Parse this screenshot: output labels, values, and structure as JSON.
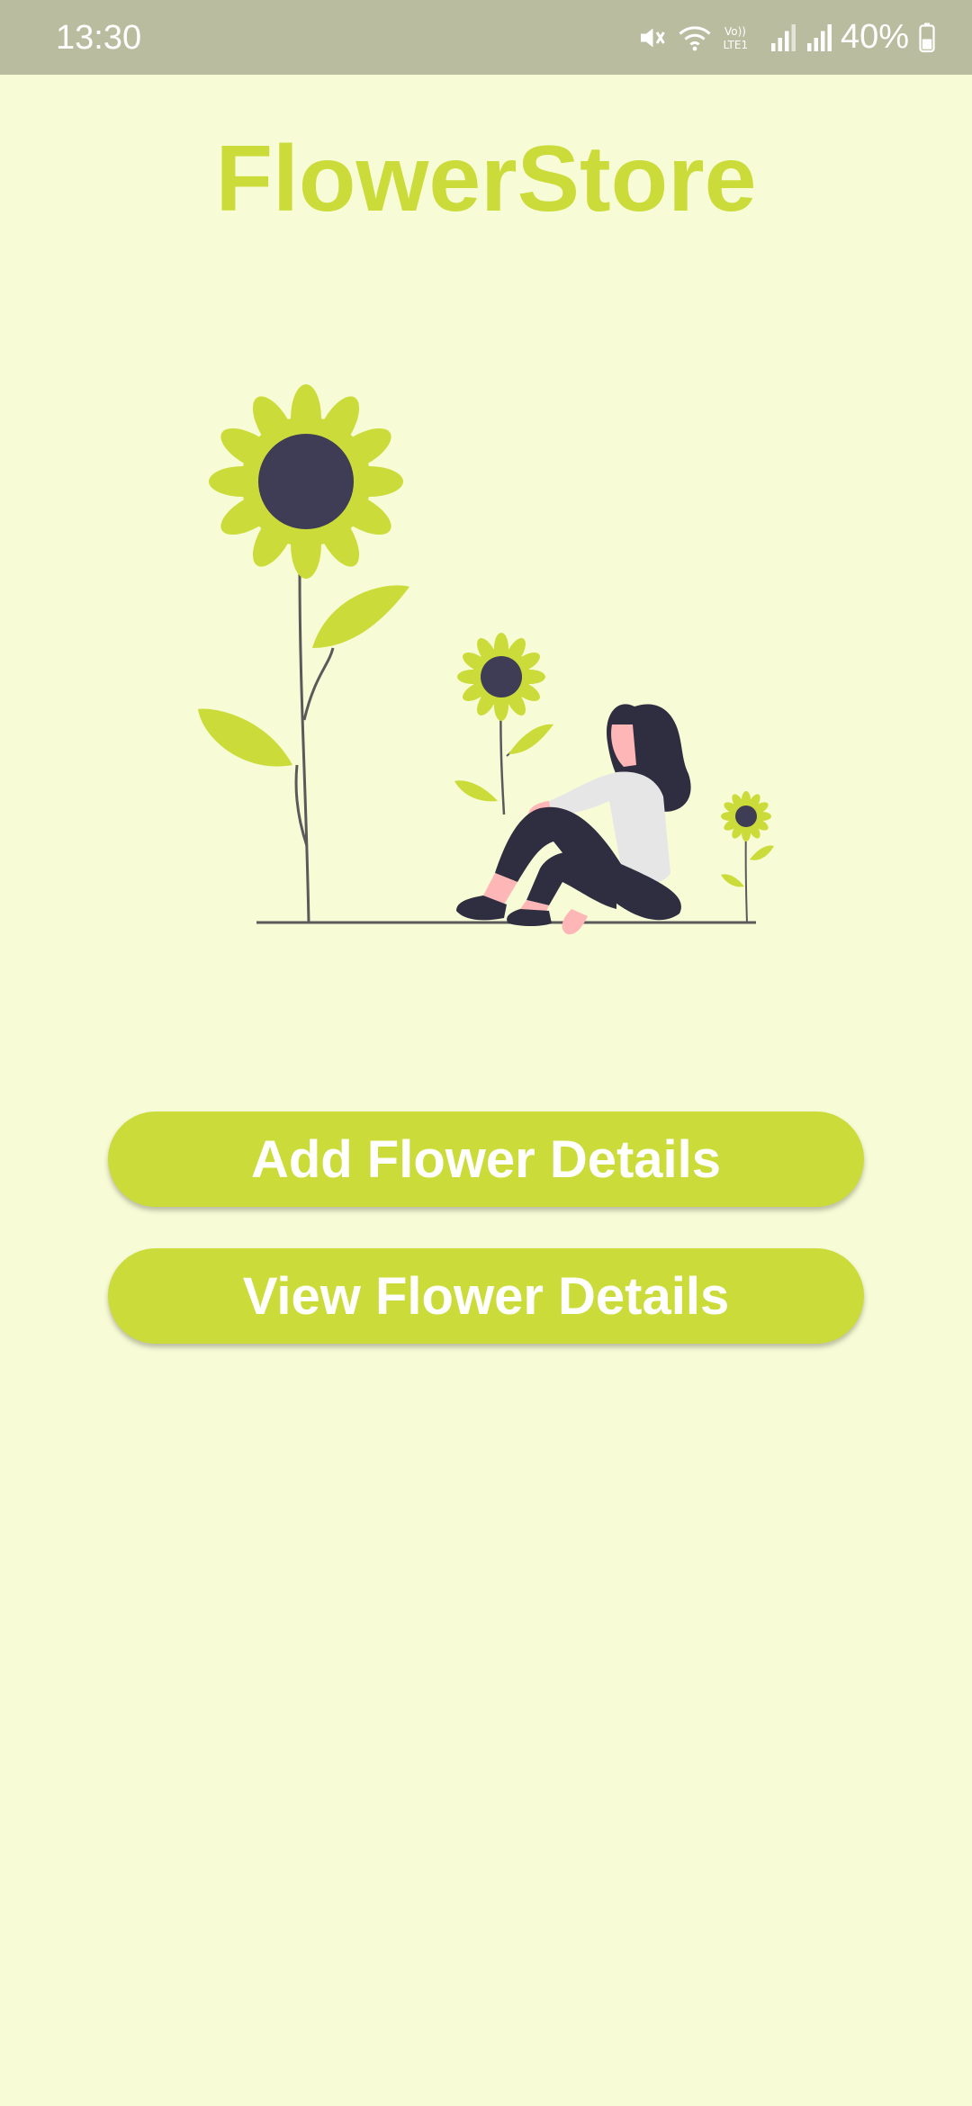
{
  "status_bar": {
    "time": "13:30",
    "battery": "40%",
    "icons": [
      "mute-icon",
      "wifi-icon",
      "volte-icon",
      "signal-icon",
      "signal-icon",
      "battery-icon"
    ]
  },
  "app": {
    "title": "FlowerStore"
  },
  "hero": {
    "illustration": "woman-sitting-with-sunflowers"
  },
  "buttons": {
    "add_label": "Add Flower Details",
    "view_label": "View Flower Details"
  },
  "colors": {
    "background": "#f8fcd6",
    "accent": "#cbdc3a",
    "status_bar": "#b9bc9e",
    "dark": "#3f3d56"
  }
}
